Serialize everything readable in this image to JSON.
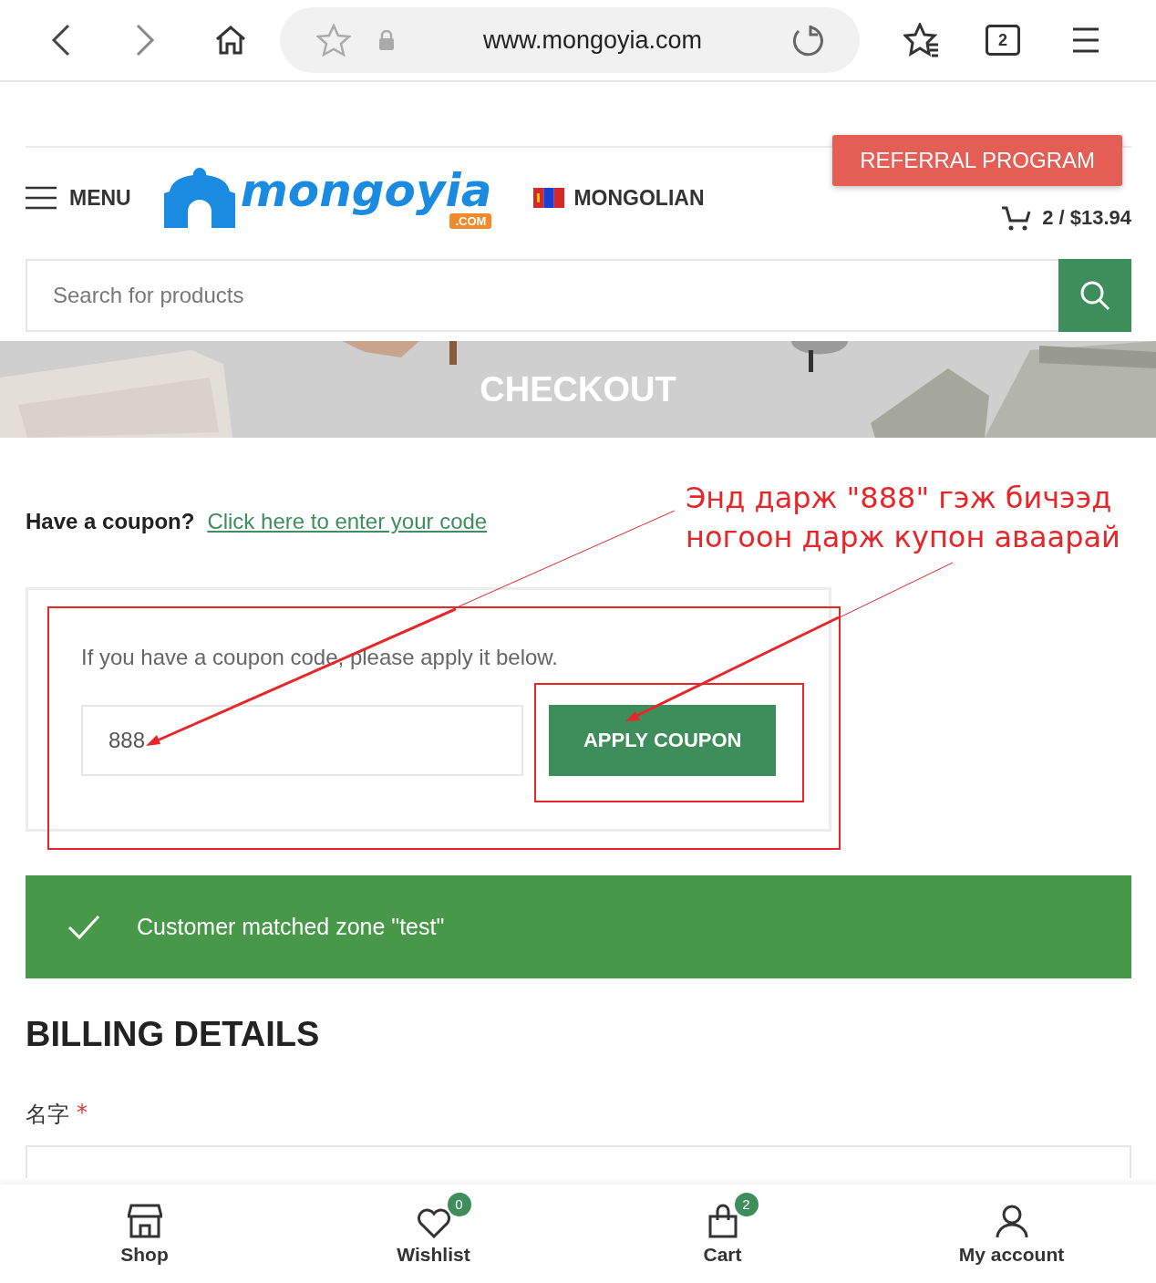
{
  "browser": {
    "url": "www.mongoyia.com",
    "tab_count": "2"
  },
  "header": {
    "menu_label": "MENU",
    "logo": {
      "name": "mongoyia",
      "suffix": ".COM"
    },
    "language": "MONGOLIAN",
    "cart_summary": "2 / $13.94",
    "referral_button": "REFERRAL PROGRAM"
  },
  "search": {
    "placeholder": "Search for products"
  },
  "banner": {
    "kind": "picture",
    "title": "CHECKOUT"
  },
  "coupon": {
    "prompt": "Have a coupon?",
    "link": "Click here to enter your code",
    "description": "If you have a coupon code, please apply it below.",
    "code_value": "888",
    "apply_button": "APPLY COUPON"
  },
  "notice": {
    "text": "Customer matched zone \"test\""
  },
  "billing": {
    "heading": "BILLING DETAILS",
    "field_label": "名字",
    "required_mark": "*"
  },
  "annotation": {
    "lines": [
      "Энд дарж \"888\" гэж бичээд",
      "ногоон дарж купон аваарай"
    ]
  },
  "bottom_nav": [
    {
      "label": "Shop"
    },
    {
      "label": "Wishlist",
      "badge": "0"
    },
    {
      "label": "Cart",
      "badge": "2"
    },
    {
      "label": "My account"
    }
  ]
}
